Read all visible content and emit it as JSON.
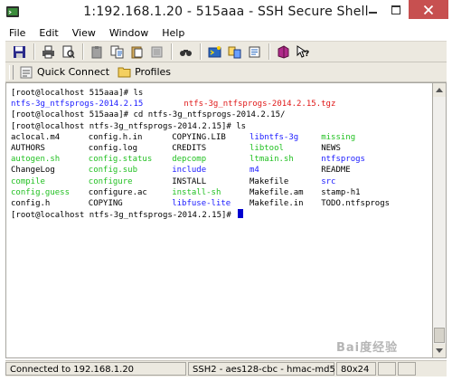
{
  "window": {
    "title": "1:192.168.1.20 - 515aaa - SSH Secure Shell"
  },
  "menu": [
    "File",
    "Edit",
    "View",
    "Window",
    "Help"
  ],
  "toolbar": {
    "icons": [
      "save-icon",
      "print-icon",
      "print-preview-icon",
      "paste-icon",
      "copy-icon",
      "paste-special-icon",
      "select-all-icon",
      "find-icon",
      "new-terminal-icon",
      "file-transfer-icon",
      "settings-icon",
      "profiles-icon",
      "help-icon"
    ]
  },
  "quickbar": {
    "quick_connect": "Quick Connect",
    "profiles": "Profiles"
  },
  "terminal": {
    "lines": [
      [
        {
          "t": "[root@localhost 515aaa]# ls",
          "c": "black",
          "col": 0
        }
      ],
      [
        {
          "t": "ntfs-3g_ntfsprogs-2014.2.15",
          "c": "blue",
          "col": 0
        },
        {
          "t": "ntfs-3g_ntfsprogs-2014.2.15.tgz",
          "c": "red",
          "col": 29
        }
      ],
      [
        {
          "t": "[root@localhost 515aaa]# cd ntfs-3g_ntfsprogs-2014.2.15/",
          "c": "black",
          "col": 0
        }
      ],
      [
        {
          "t": "[root@localhost ntfs-3g_ntfsprogs-2014.2.15]# ls",
          "c": "black",
          "col": 0
        }
      ],
      [
        {
          "t": "aclocal.m4",
          "c": "black",
          "col": 0
        },
        {
          "t": "config.h.in",
          "c": "black",
          "col": 13
        },
        {
          "t": "COPYING.LIB",
          "c": "black",
          "col": 27
        },
        {
          "t": "libntfs-3g",
          "c": "blue",
          "col": 40
        },
        {
          "t": "missing",
          "c": "green",
          "col": 52
        }
      ],
      [
        {
          "t": "AUTHORS",
          "c": "black",
          "col": 0
        },
        {
          "t": "config.log",
          "c": "black",
          "col": 13
        },
        {
          "t": "CREDITS",
          "c": "black",
          "col": 27
        },
        {
          "t": "libtool",
          "c": "green",
          "col": 40
        },
        {
          "t": "NEWS",
          "c": "black",
          "col": 52
        }
      ],
      [
        {
          "t": "autogen.sh",
          "c": "green",
          "col": 0
        },
        {
          "t": "config.status",
          "c": "green",
          "col": 13
        },
        {
          "t": "depcomp",
          "c": "green",
          "col": 27
        },
        {
          "t": "ltmain.sh",
          "c": "green",
          "col": 40
        },
        {
          "t": "ntfsprogs",
          "c": "blue",
          "col": 52
        }
      ],
      [
        {
          "t": "ChangeLog",
          "c": "black",
          "col": 0
        },
        {
          "t": "config.sub",
          "c": "green",
          "col": 13
        },
        {
          "t": "include",
          "c": "blue",
          "col": 27
        },
        {
          "t": "m4",
          "c": "blue",
          "col": 40
        },
        {
          "t": "README",
          "c": "black",
          "col": 52
        }
      ],
      [
        {
          "t": "compile",
          "c": "green",
          "col": 0
        },
        {
          "t": "configure",
          "c": "green",
          "col": 13
        },
        {
          "t": "INSTALL",
          "c": "black",
          "col": 27
        },
        {
          "t": "Makefile",
          "c": "black",
          "col": 40
        },
        {
          "t": "src",
          "c": "blue",
          "col": 52
        }
      ],
      [
        {
          "t": "config.guess",
          "c": "green",
          "col": 0
        },
        {
          "t": "configure.ac",
          "c": "black",
          "col": 13
        },
        {
          "t": "install-sh",
          "c": "green",
          "col": 27
        },
        {
          "t": "Makefile.am",
          "c": "black",
          "col": 40
        },
        {
          "t": "stamp-h1",
          "c": "black",
          "col": 52
        }
      ],
      [
        {
          "t": "config.h",
          "c": "black",
          "col": 0
        },
        {
          "t": "COPYING",
          "c": "black",
          "col": 13
        },
        {
          "t": "libfuse-lite",
          "c": "blue",
          "col": 27
        },
        {
          "t": "Makefile.in",
          "c": "black",
          "col": 40
        },
        {
          "t": "TODO.ntfsprogs",
          "c": "black",
          "col": 52
        }
      ],
      [
        {
          "t": "[root@localhost ntfs-3g_ntfsprogs-2014.2.15]# ",
          "c": "black",
          "col": 0,
          "cursor": true
        }
      ]
    ]
  },
  "statusbar": {
    "connection": "Connected to 192.168.1.20",
    "cipher": "SSH2 - aes128-cbc - hmac-md5",
    "size": "80x24"
  },
  "watermark": "Bai度经验",
  "colors": {
    "green": "#22c022",
    "blue": "#1a1aff",
    "red": "#e01818",
    "cursor": "#0000d0",
    "close": "#c75050"
  }
}
